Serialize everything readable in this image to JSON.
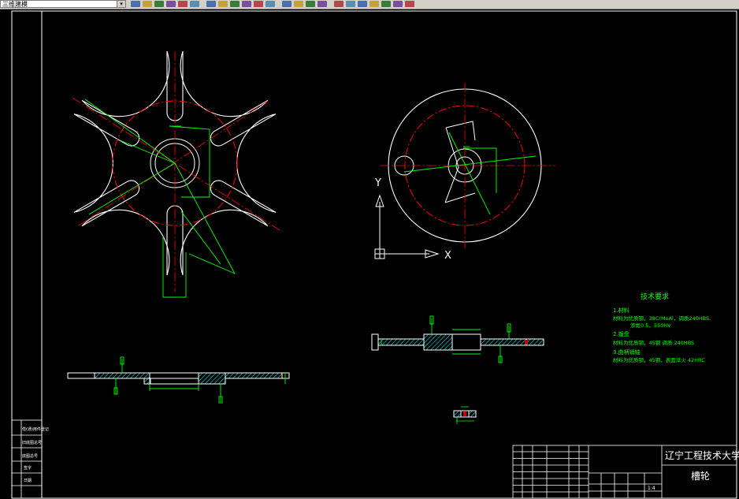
{
  "toolbar": {
    "layer_value": "三维建模",
    "icons": [
      "new-icon",
      "open-icon",
      "save-icon",
      "plot-icon",
      "preview-icon",
      "publish-icon",
      "cut-icon",
      "copy-icon",
      "paste-icon",
      "matchprop-icon",
      "undo-icon",
      "redo-icon",
      "pan-icon",
      "zoom-realtime-icon",
      "zoom-window-icon",
      "zoom-previous-icon",
      "properties-icon",
      "designcenter-icon",
      "toolpalette-icon",
      "sheetset-icon",
      "markup-icon",
      "calc-icon",
      "layer-icon"
    ]
  },
  "ucs": {
    "x_label": "X",
    "y_label": "Y"
  },
  "tech_req": {
    "title": "技术要求",
    "item1_title": "1.材料",
    "item1_line1": "材料为优质钢，38CrMoAl，调质240HBS,",
    "item1_line2": "渗氮0.5，550HV",
    "item2_title": "2.拨盘",
    "item2_line1": "材料为优质钢，45钢    调质 240HBS",
    "item3_title": "3.曲柄销轴",
    "item3_line1": "材料为优质钢，45钢，表面淬火 42HRC"
  },
  "title_block": {
    "school": "辽宁工程技术大学",
    "part_name": "槽轮",
    "scale": "1:4"
  },
  "side_strip": {
    "labels": [
      "借(通)用件登记",
      "旧底图总号",
      "底图总号",
      "签字",
      "日期"
    ]
  },
  "colors": {
    "background": "#000000",
    "outline": "#ffffff",
    "centerline": "#ff0000",
    "dimension": "#00ff00",
    "hatch": "#00c8c8",
    "toolbar": "#d4d0c8"
  }
}
